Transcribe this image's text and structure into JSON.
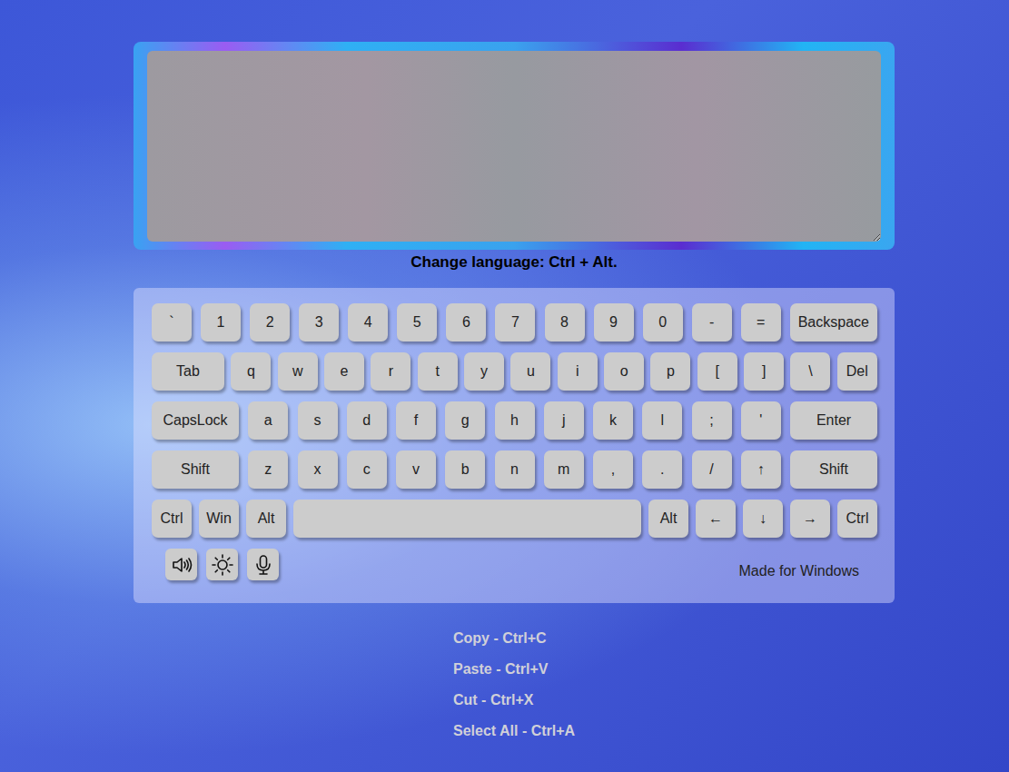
{
  "editor": {
    "value": ""
  },
  "hint": "Change language: Ctrl + Alt.",
  "keyboard": {
    "rows": [
      [
        {
          "label": "`",
          "kind": "char"
        },
        {
          "label": "1",
          "kind": "char"
        },
        {
          "label": "2",
          "kind": "char"
        },
        {
          "label": "3",
          "kind": "char"
        },
        {
          "label": "4",
          "kind": "char"
        },
        {
          "label": "5",
          "kind": "char"
        },
        {
          "label": "6",
          "kind": "char"
        },
        {
          "label": "7",
          "kind": "char"
        },
        {
          "label": "8",
          "kind": "char"
        },
        {
          "label": "9",
          "kind": "char"
        },
        {
          "label": "0",
          "kind": "char"
        },
        {
          "label": "-",
          "kind": "char"
        },
        {
          "label": "=",
          "kind": "char"
        },
        {
          "label": "Backspace",
          "kind": "wide"
        }
      ],
      [
        {
          "label": "Tab",
          "kind": "medium"
        },
        {
          "label": "q",
          "kind": "char"
        },
        {
          "label": "w",
          "kind": "char"
        },
        {
          "label": "e",
          "kind": "char"
        },
        {
          "label": "r",
          "kind": "char"
        },
        {
          "label": "t",
          "kind": "char"
        },
        {
          "label": "y",
          "kind": "char"
        },
        {
          "label": "u",
          "kind": "char"
        },
        {
          "label": "i",
          "kind": "char"
        },
        {
          "label": "o",
          "kind": "char"
        },
        {
          "label": "p",
          "kind": "char"
        },
        {
          "label": "[",
          "kind": "char"
        },
        {
          "label": "]",
          "kind": "char"
        },
        {
          "label": "\\",
          "kind": "char"
        },
        {
          "label": "Del",
          "kind": "char"
        }
      ],
      [
        {
          "label": "CapsLock",
          "kind": "wide"
        },
        {
          "label": "a",
          "kind": "char"
        },
        {
          "label": "s",
          "kind": "char"
        },
        {
          "label": "d",
          "kind": "char"
        },
        {
          "label": "f",
          "kind": "char"
        },
        {
          "label": "g",
          "kind": "char"
        },
        {
          "label": "h",
          "kind": "char"
        },
        {
          "label": "j",
          "kind": "char"
        },
        {
          "label": "k",
          "kind": "char"
        },
        {
          "label": "l",
          "kind": "char"
        },
        {
          "label": ";",
          "kind": "char"
        },
        {
          "label": "'",
          "kind": "char"
        },
        {
          "label": "Enter",
          "kind": "wide"
        }
      ],
      [
        {
          "label": "Shift",
          "kind": "wide"
        },
        {
          "label": "z",
          "kind": "char"
        },
        {
          "label": "x",
          "kind": "char"
        },
        {
          "label": "c",
          "kind": "char"
        },
        {
          "label": "v",
          "kind": "char"
        },
        {
          "label": "b",
          "kind": "char"
        },
        {
          "label": "n",
          "kind": "char"
        },
        {
          "label": "m",
          "kind": "char"
        },
        {
          "label": ",",
          "kind": "char"
        },
        {
          "label": ".",
          "kind": "char"
        },
        {
          "label": "/",
          "kind": "char"
        },
        {
          "label": "↑",
          "kind": "char"
        },
        {
          "label": "Shift",
          "kind": "wide"
        }
      ],
      [
        {
          "label": "Ctrl",
          "kind": "char"
        },
        {
          "label": "Win",
          "kind": "char"
        },
        {
          "label": "Alt",
          "kind": "char"
        },
        {
          "label": "",
          "kind": "space"
        },
        {
          "label": "Alt",
          "kind": "char"
        },
        {
          "label": "←",
          "kind": "char"
        },
        {
          "label": "↓",
          "kind": "char"
        },
        {
          "label": "→",
          "kind": "char"
        },
        {
          "label": "Ctrl",
          "kind": "char"
        }
      ]
    ]
  },
  "footer": "Made for Windows",
  "shortcuts": [
    "Copy - Ctrl+C",
    "Paste - Ctrl+V",
    "Cut - Ctrl+X",
    "Select All - Ctrl+A"
  ]
}
